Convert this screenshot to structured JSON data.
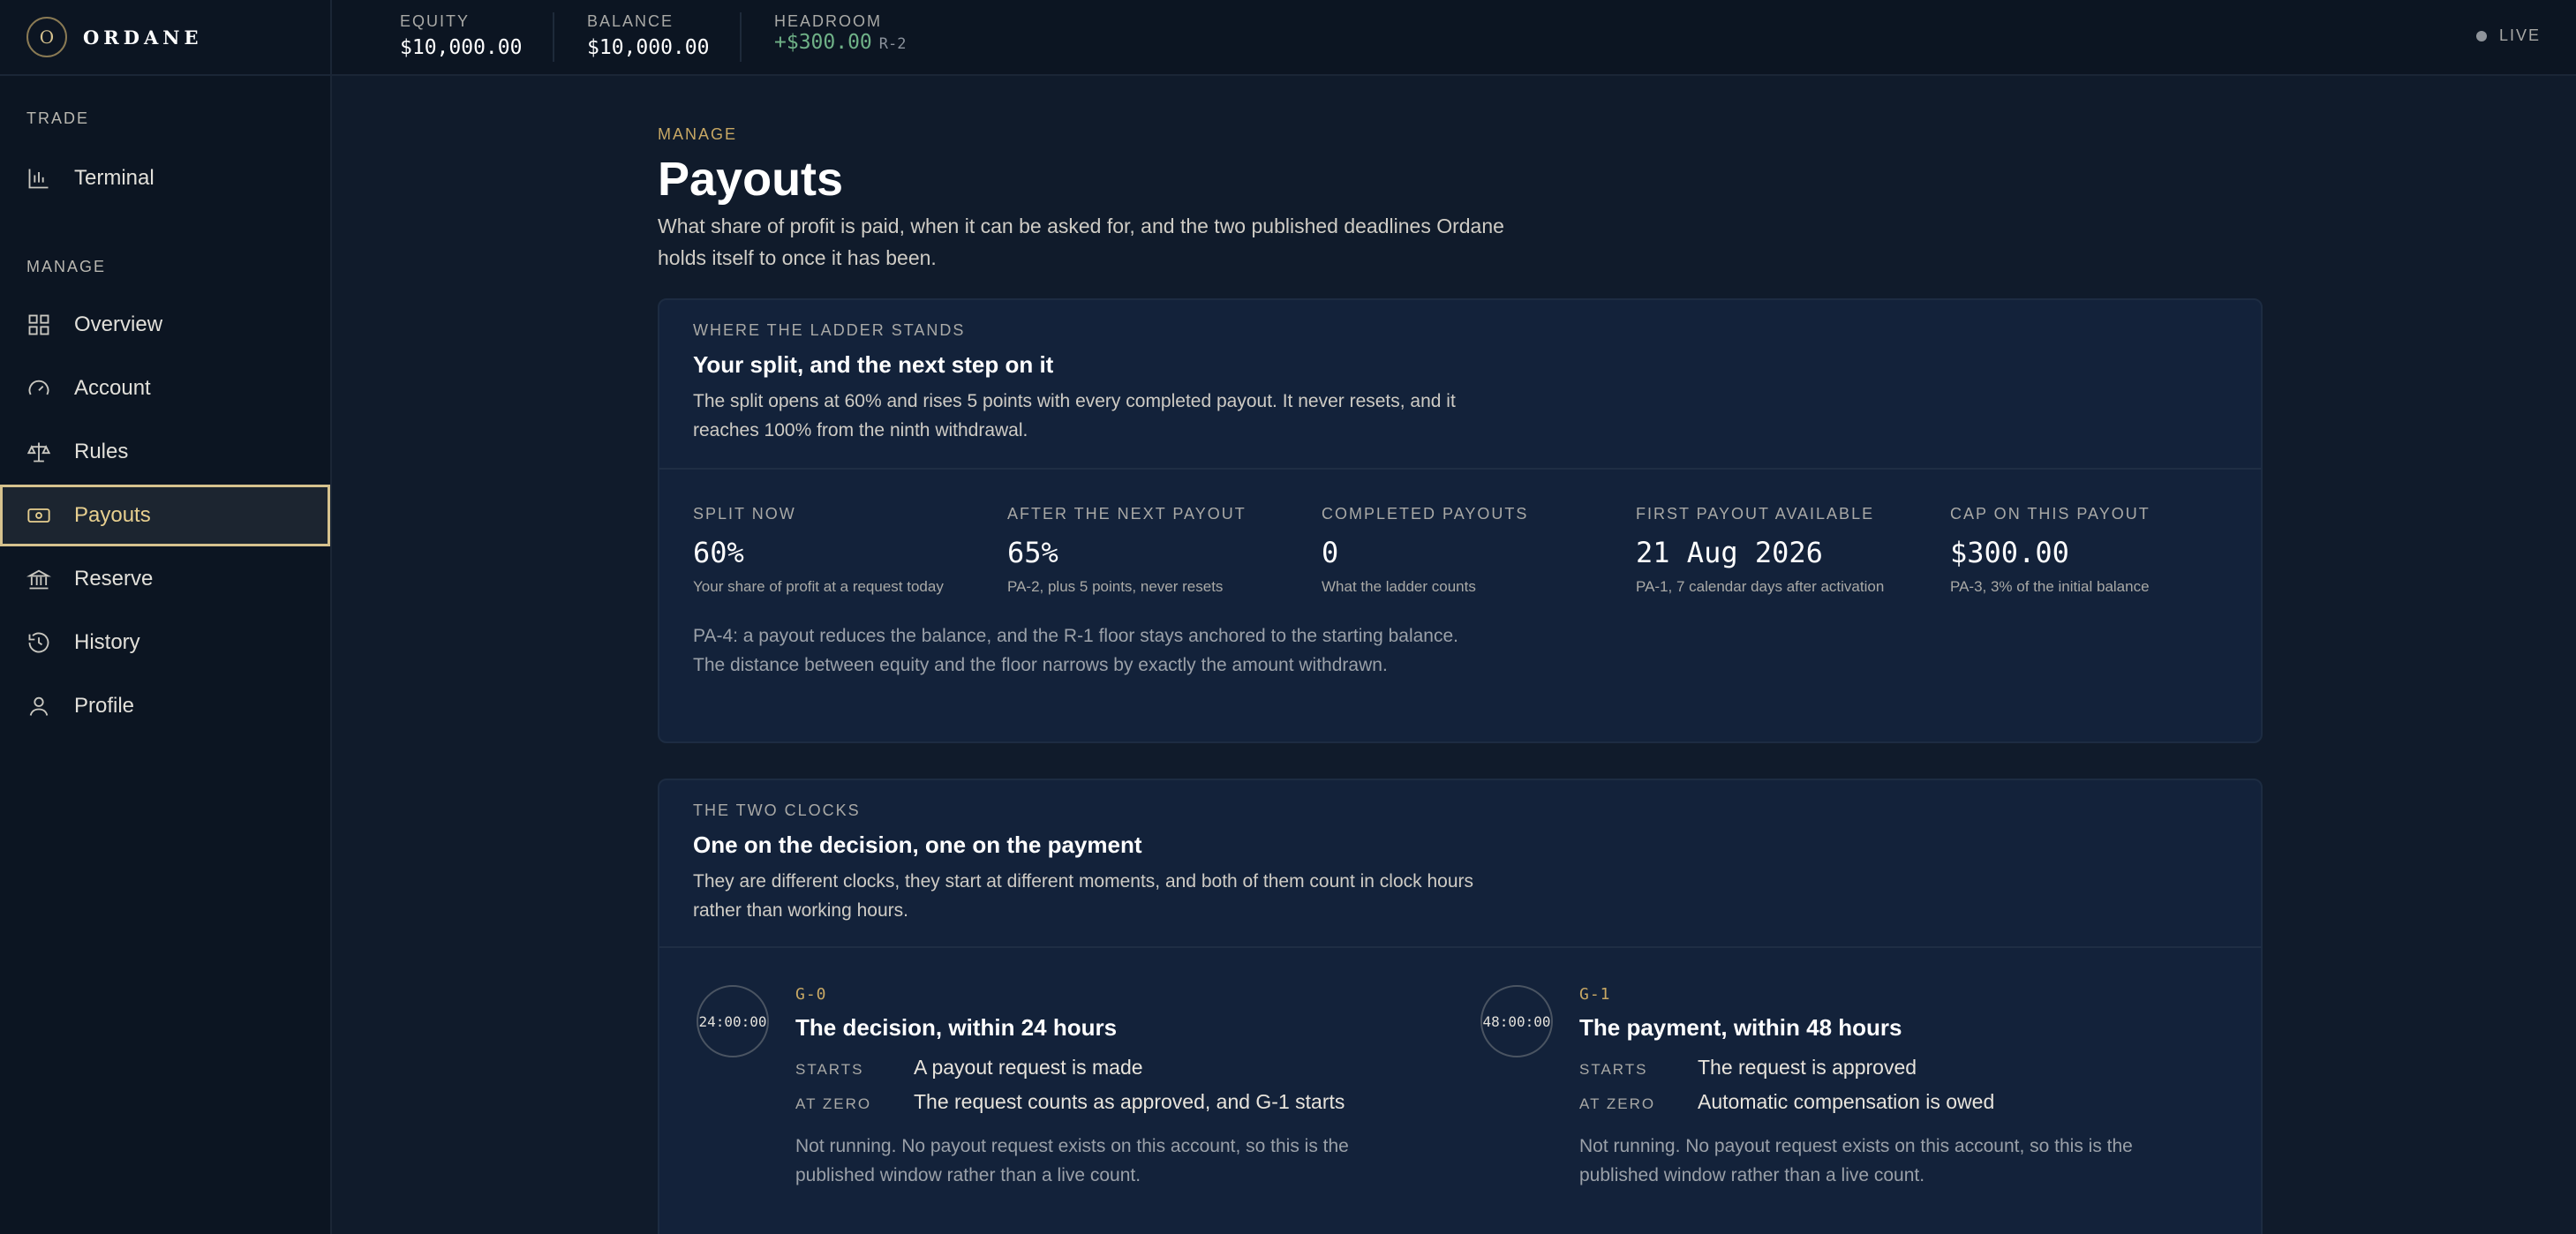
{
  "brand": {
    "logo_letter": "O",
    "name": "ORDANE"
  },
  "sidebar": {
    "sections": [
      {
        "label": "TRADE",
        "items": [
          {
            "label": "Terminal",
            "icon": "chart-icon"
          }
        ]
      },
      {
        "label": "MANAGE",
        "items": [
          {
            "label": "Overview",
            "icon": "grid-icon"
          },
          {
            "label": "Account",
            "icon": "gauge-icon"
          },
          {
            "label": "Rules",
            "icon": "scale-icon"
          },
          {
            "label": "Payouts",
            "icon": "banknote-icon",
            "active": true
          },
          {
            "label": "Reserve",
            "icon": "bank-icon"
          },
          {
            "label": "History",
            "icon": "history-icon"
          },
          {
            "label": "Profile",
            "icon": "user-icon"
          }
        ]
      }
    ]
  },
  "topbar": {
    "metrics": [
      {
        "label": "EQUITY",
        "value": "$10,000.00"
      },
      {
        "label": "BALANCE",
        "value": "$10,000.00"
      },
      {
        "label": "HEADROOM",
        "value": "+$300.00",
        "tag": "R-2"
      }
    ],
    "status": "LIVE"
  },
  "page": {
    "eyebrow": "MANAGE",
    "title": "Payouts",
    "description": "What share of profit is paid, when it can be asked for, and the two published deadlines Ordane holds itself to once it has been."
  },
  "ladder": {
    "eyebrow": "WHERE THE LADDER STANDS",
    "title": "Your split, and the next step on it",
    "description": "The split opens at 60% and rises 5 points with every completed payout. It never resets, and it reaches 100% from the ninth withdrawal.",
    "stats": [
      {
        "label": "SPLIT NOW",
        "value": "60%",
        "note": "Your share of profit at a request today"
      },
      {
        "label": "AFTER THE NEXT PAYOUT",
        "value": "65%",
        "note": "PA-2, plus 5 points, never resets"
      },
      {
        "label": "COMPLETED PAYOUTS",
        "value": "0",
        "note": "What the ladder counts"
      },
      {
        "label": "FIRST PAYOUT AVAILABLE",
        "value": "21 Aug 2026",
        "note": "PA-1, 7 calendar days after activation"
      },
      {
        "label": "CAP ON THIS PAYOUT",
        "value": "$300.00",
        "note": "PA-3, 3% of the initial balance"
      }
    ],
    "footnote": "PA-4: a payout reduces the balance, and the R-1 floor stays anchored to the starting balance. The distance between equity and the floor narrows by exactly the amount withdrawn."
  },
  "clocks": {
    "eyebrow": "THE TWO CLOCKS",
    "title": "One on the decision, one on the payment",
    "description": "They are different clocks, they start at different moments, and both of them count in clock hours rather than working hours.",
    "items": [
      {
        "ring": "24:00:00",
        "code": "G-0",
        "title": "The decision, within 24 hours",
        "starts_label": "STARTS",
        "starts": "A payout request is made",
        "zero_label": "AT ZERO",
        "zero": "The request counts as approved, and G-1 starts",
        "note": "Not running. No payout request exists on this account, so this is the published window rather than a live count."
      },
      {
        "ring": "48:00:00",
        "code": "G-1",
        "title": "The payment, within 48 hours",
        "starts_label": "STARTS",
        "starts": "The request is approved",
        "zero_label": "AT ZERO",
        "zero": "Automatic compensation is owed",
        "note": "Not running. No payout request exists on this account, so this is the published window rather than a live count."
      }
    ]
  }
}
